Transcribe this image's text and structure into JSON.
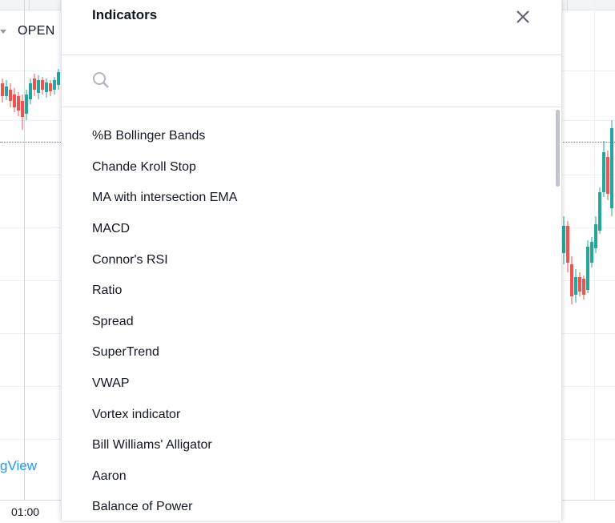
{
  "background": {
    "open_label": "OPEN",
    "brand_text": "gView",
    "time_label": "01:00",
    "colors": {
      "up": "#26a69a",
      "down": "#ef5350",
      "brand": "#2196f3"
    }
  },
  "modal": {
    "title": "Indicators",
    "close_icon": "close-icon",
    "search": {
      "placeholder": "",
      "value": "",
      "icon": "search-icon"
    },
    "items": [
      {
        "label": "%B Bollinger Bands"
      },
      {
        "label": "Chande Kroll Stop"
      },
      {
        "label": "MA with intersection EMA"
      },
      {
        "label": "MACD"
      },
      {
        "label": "Connor's RSI"
      },
      {
        "label": "Ratio"
      },
      {
        "label": "Spread"
      },
      {
        "label": "SuperTrend"
      },
      {
        "label": "VWAP"
      },
      {
        "label": "Vortex indicator"
      },
      {
        "label": "Bill Williams' Alligator"
      },
      {
        "label": "Aaron"
      },
      {
        "label": "Balance of Power"
      }
    ]
  }
}
